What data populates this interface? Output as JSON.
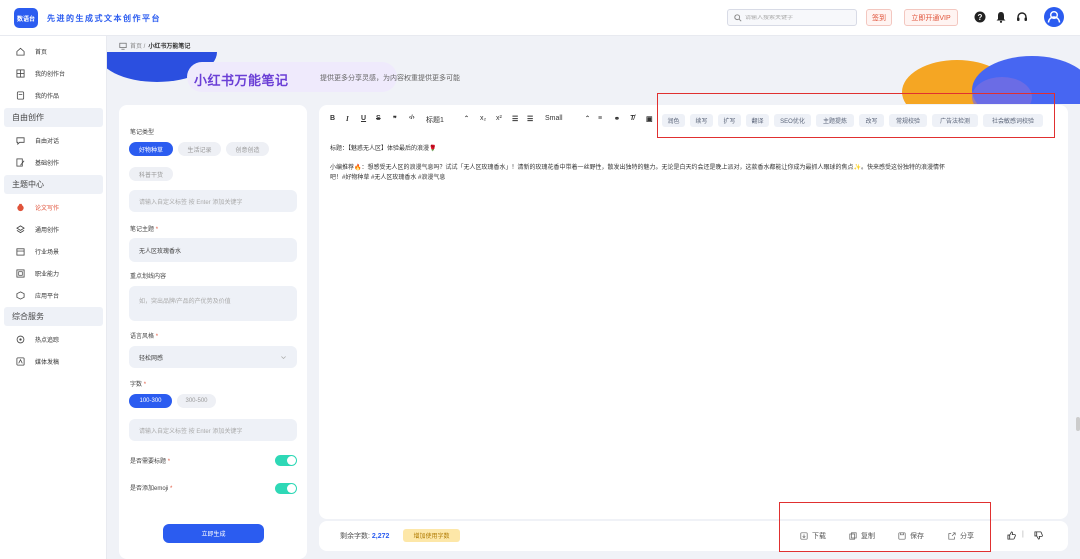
{
  "header": {
    "logo_text": "数语台",
    "slogan": "先进的生成式文本创作平台",
    "search_placeholder": "请输入搜索关键字",
    "signin_label": "签到",
    "vip_label": "立即开通VIP"
  },
  "sidebar": {
    "items": [
      {
        "label": "首页",
        "icon": "home-icon"
      },
      {
        "label": "我的创作台",
        "icon": "workbench-icon"
      },
      {
        "label": "我的作品",
        "icon": "works-icon"
      }
    ],
    "group1": "自由创作",
    "group1_items": [
      {
        "label": "自由对话",
        "icon": "chat-icon"
      },
      {
        "label": "基础创作",
        "icon": "edit-icon"
      }
    ],
    "group2": "主题中心",
    "group2_items": [
      {
        "label": "论文写作",
        "icon": "paper-icon"
      },
      {
        "label": "通用创作",
        "icon": "layers-icon"
      },
      {
        "label": "行业场景",
        "icon": "industry-icon"
      },
      {
        "label": "职业能力",
        "icon": "career-icon"
      },
      {
        "label": "应用平台",
        "icon": "platform-icon"
      }
    ],
    "group3": "综合服务",
    "group3_items": [
      {
        "label": "热点追踪",
        "icon": "hotspot-icon"
      },
      {
        "label": "媒体发稿",
        "icon": "media-icon"
      }
    ]
  },
  "breadcrumb": {
    "home": "首页 /",
    "current": "小红书万能笔记"
  },
  "banner": {
    "title": "小红书万能笔记",
    "subtitle": "提供更多分享灵感，为内容权重提供更多可能"
  },
  "form": {
    "note_type_label": "笔记类型",
    "note_types": [
      "好物种草",
      "生活记录",
      "创意创造",
      "科普干货"
    ],
    "custom_tag_placeholder": "请输入自定义标签 按 Enter 添加关键字",
    "topic_label": "笔记主题",
    "topic_value": "无人区玫瑰香水",
    "highlight_label": "重点划线内容",
    "highlight_placeholder": "如，突出品牌/产品的产优势及价值",
    "style_label": "语言风格",
    "style_value": "轻松网感",
    "words_label": "字数",
    "word_options": [
      "100-300",
      "300-500"
    ],
    "words_tag_placeholder": "请输入自定义标签 按 Enter 添加关键字",
    "need_title_label": "是否需要标题",
    "add_emoji_label": "是否添加emoji",
    "generate_label": "立即生成"
  },
  "toolbar": {
    "heading": "标题1",
    "size": "Small",
    "tags": [
      "润色",
      "续写",
      "扩写",
      "翻译",
      "SEO优化",
      "主题提炼",
      "改写",
      "常规校验",
      "广告法检测",
      "社会敏感词校验"
    ]
  },
  "content": {
    "title_line": "标题：【魅惑无人区】体验最后的浪漫🌹",
    "body_line1": "小编推荐🔥：想感受无人区的浪漫气息吗？试试「无人区玫瑰香水」！清新的玫瑰花香中带着一丝野性，散发出独特的魅力。无论是白天约会还是晚上派对，这款香水都能让你成为最抓人眼球的焦点✨。快来感受这份独特的浪漫情怀",
    "body_line2": "吧！#好物种草 #无人区玫瑰香水 #浪漫气息"
  },
  "footer": {
    "remain_label": "剩余字数:",
    "remain_value": "2,272",
    "add_words_label": "增加使用字数",
    "download": "下载",
    "copy": "复制",
    "save": "保存",
    "share": "分享",
    "divider": "|"
  },
  "colors": {
    "accent": "#2b5cf0",
    "alert": "#e0533a",
    "toggle": "#2ed8b6",
    "highlight_box": "#e03030"
  }
}
